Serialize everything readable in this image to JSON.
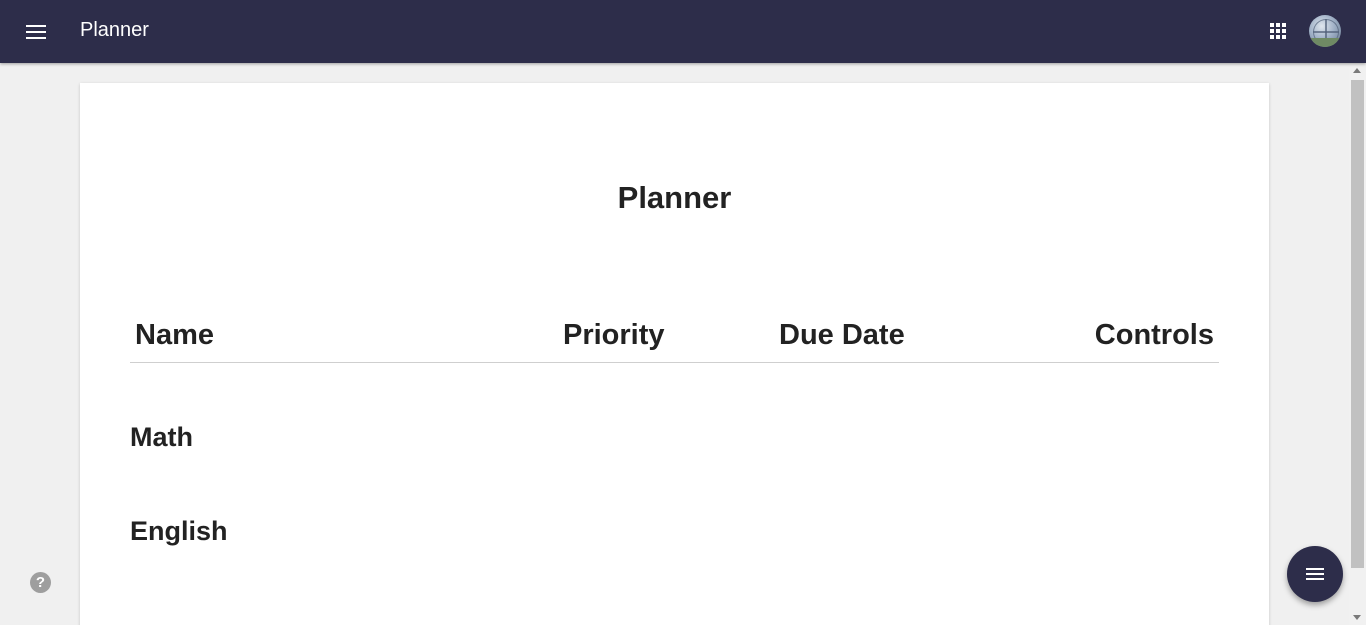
{
  "topbar": {
    "title": "Planner",
    "menu_icon": "hamburger-menu-icon",
    "apps_icon": "apps-grid-icon",
    "avatar_icon": "user-avatar"
  },
  "colors": {
    "topbar_bg": "#2d2d4a",
    "page_bg": "#f0f0f0",
    "card_bg": "#ffffff",
    "fab_bg": "#2d2d4a",
    "help_icon": "#9e9e9e"
  },
  "main": {
    "title": "Planner",
    "table": {
      "columns": [
        "Name",
        "Priority",
        "Due Date",
        "Controls"
      ]
    },
    "subjects": [
      "Math",
      "English"
    ]
  },
  "help": {
    "icon": "help-icon",
    "glyph": "?"
  },
  "fab": {
    "icon": "list-menu-icon"
  }
}
